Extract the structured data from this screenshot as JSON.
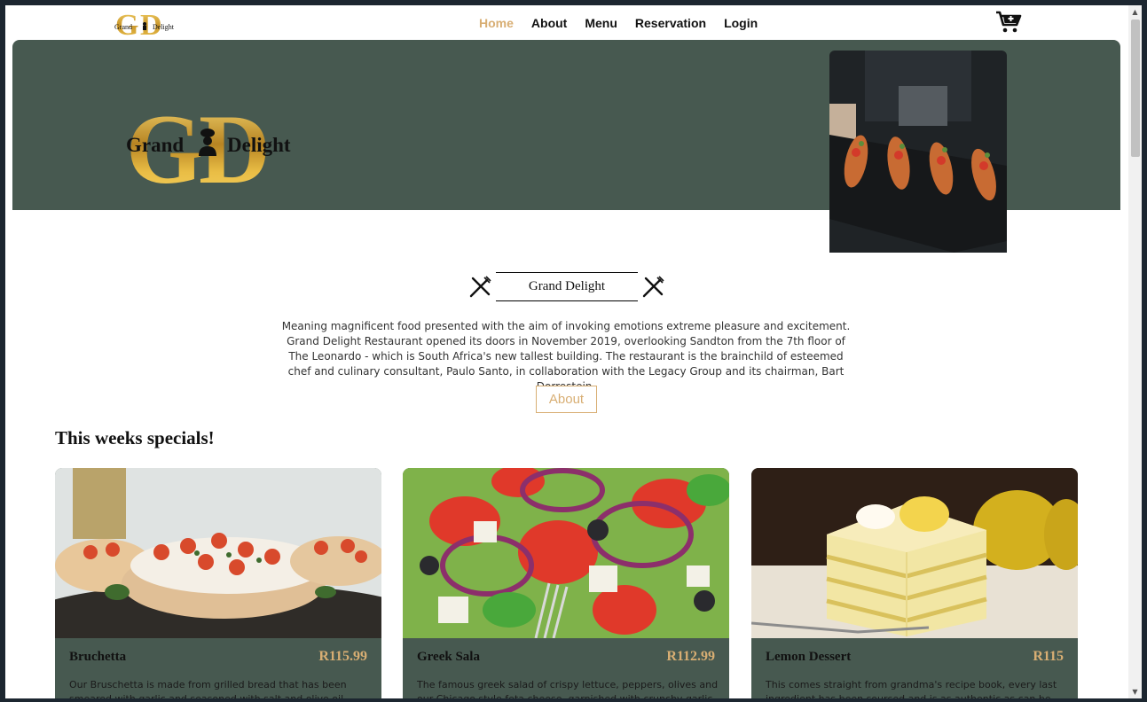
{
  "nav": {
    "logo_text_left": "Grand",
    "logo_text_right": "Delight",
    "links": [
      {
        "label": "Home",
        "active": true
      },
      {
        "label": "About",
        "active": false
      },
      {
        "label": "Menu",
        "active": false
      },
      {
        "label": "Reservation",
        "active": false
      },
      {
        "label": "Login",
        "active": false
      }
    ],
    "cart_icon": "cart-add-icon"
  },
  "hero": {
    "logo_text_left": "Grand",
    "logo_text_right": "Delight",
    "image": "eclairs-on-slate-photo"
  },
  "intro": {
    "title": "Grand Delight",
    "body": "Meaning magnificent food presented with the aim of invoking emotions extreme pleasure and excitement. Grand Delight Restaurant opened its doors in November 2019, overlooking Sandton from the 7th floor of The Leonardo - which is South Africa's new tallest building. The restaurant is the brainchild of esteemed chef and culinary consultant, Paulo Santo, in collaboration with the Legacy Group and its chairman, Bart Dorrestein.",
    "button_label": "About"
  },
  "specials": {
    "heading": "This weeks specials!",
    "items": [
      {
        "name": "Bruchetta",
        "price": "R115.99",
        "description": "Our Bruschetta is made from grilled bread that has been smeared with garlic and seasoned with salt and olive oil",
        "image": "bruschetta-photo"
      },
      {
        "name": "Greek Sala",
        "price": "R112.99",
        "description": "The famous greek salad of crispy lettuce, peppers, olives and our Chicago style feta cheese, garnished with crunchy garlic and",
        "image": "greek-salad-photo"
      },
      {
        "name": "Lemon Dessert",
        "price": "R115",
        "description": "This comes straight from grandma's recipe book, every last ingredient has been sourced and is as authentic as can be",
        "image": "lemon-cake-photo"
      }
    ]
  },
  "colors": {
    "brand_green": "#475950",
    "accent_gold": "#d8ae73",
    "text_dark": "#111111"
  }
}
